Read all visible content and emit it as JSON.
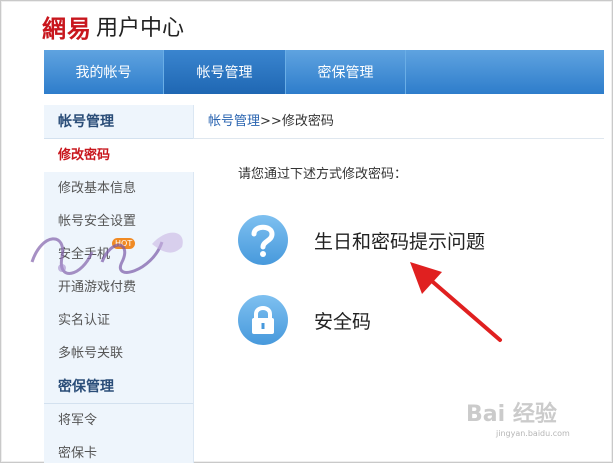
{
  "logo": {
    "brand": "網易",
    "title": "用户中心"
  },
  "topnav": [
    "我的帐号",
    "帐号管理",
    "密保管理"
  ],
  "sidebar": {
    "section1": "帐号管理",
    "items1": [
      "修改密码",
      "修改基本信息",
      "帐号安全设置",
      "安全手机",
      "开通游戏付费",
      "实名认证",
      "多帐号关联"
    ],
    "hot": "HOT",
    "section2": "密保管理",
    "items2": [
      "将军令",
      "密保卡"
    ]
  },
  "breadcrumb": {
    "parent": "帐号管理",
    "sep": ">>",
    "current": "修改密码"
  },
  "main": {
    "prompt": "请您通过下述方式修改密码：",
    "options": [
      {
        "label": "生日和密码提示问题",
        "icon": "question-icon"
      },
      {
        "label": "安全码",
        "icon": "lock-icon"
      }
    ]
  },
  "watermark": {
    "text": "Bai 经验",
    "sub": "jingyan.baidu.com"
  },
  "colors": {
    "nav": "#2e7dcb",
    "brand": "#c8161d",
    "arrow": "#e02020"
  }
}
